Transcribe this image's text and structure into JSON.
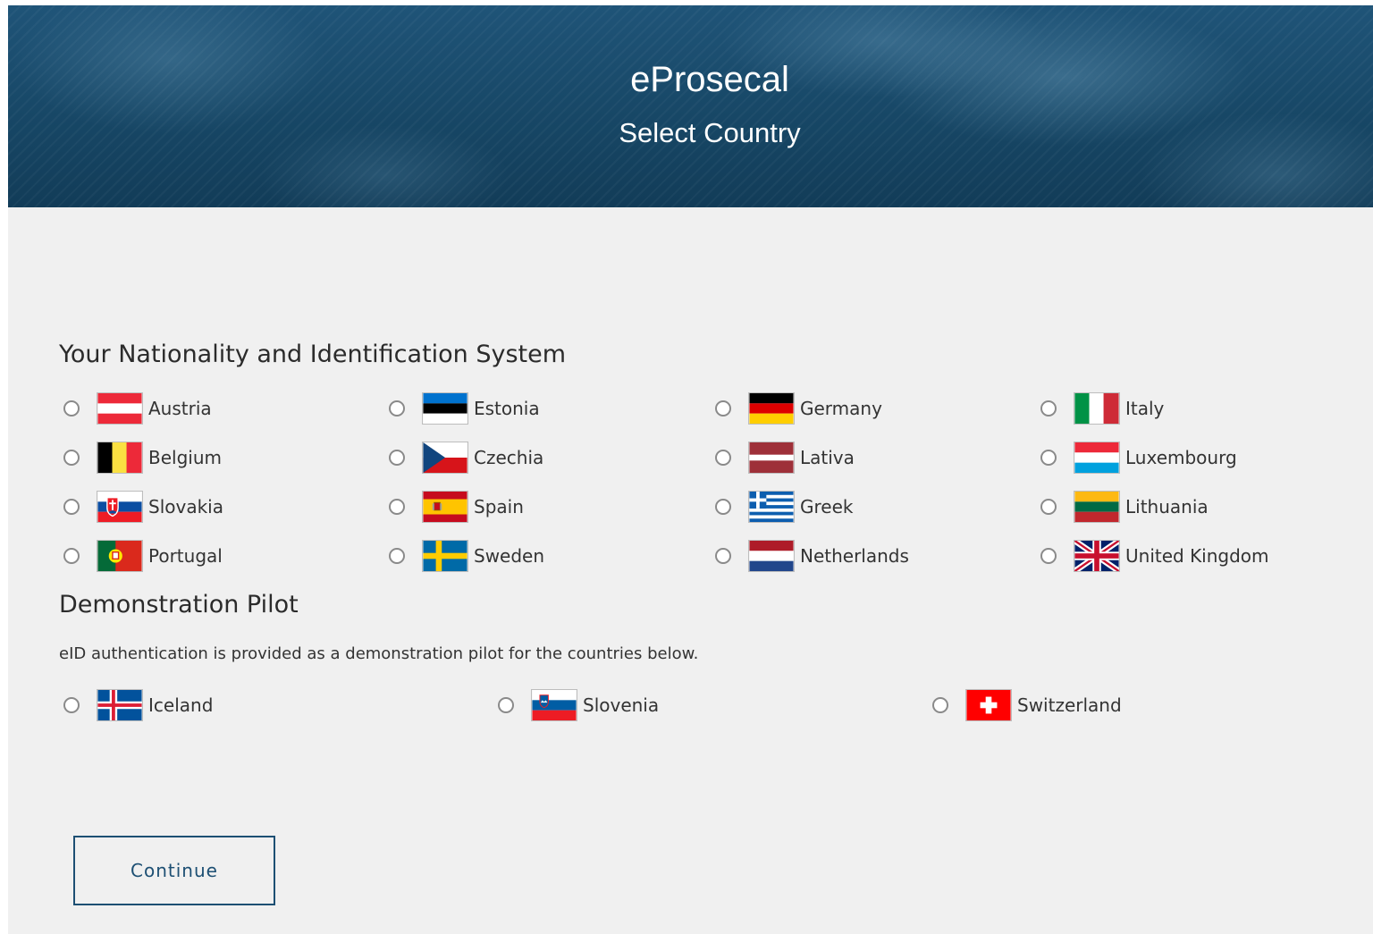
{
  "header": {
    "title": "eProsecal",
    "subtitle": "Select Country"
  },
  "nationality": {
    "heading": "Your Nationality and Identification System",
    "columns": [
      [
        "Austria",
        "Belgium",
        "Slovakia",
        "Portugal"
      ],
      [
        "Estonia",
        "Czechia",
        "Spain",
        "Sweden"
      ],
      [
        "Germany",
        "Lativa",
        "Greek",
        "Netherlands"
      ],
      [
        "Italy",
        "Luxembourg",
        "Lithuania",
        "United Kingdom"
      ]
    ]
  },
  "pilot": {
    "heading": "Demonstration Pilot",
    "description": "eID authentication is provided as a demonstration pilot for the countries below.",
    "countries": [
      "Iceland",
      "Slovenia",
      "Switzerland"
    ]
  },
  "actions": {
    "continue_label": "Continue"
  },
  "colors": {
    "banner": "#174766",
    "accent": "#1d4f73",
    "background": "#f0f0f0"
  }
}
